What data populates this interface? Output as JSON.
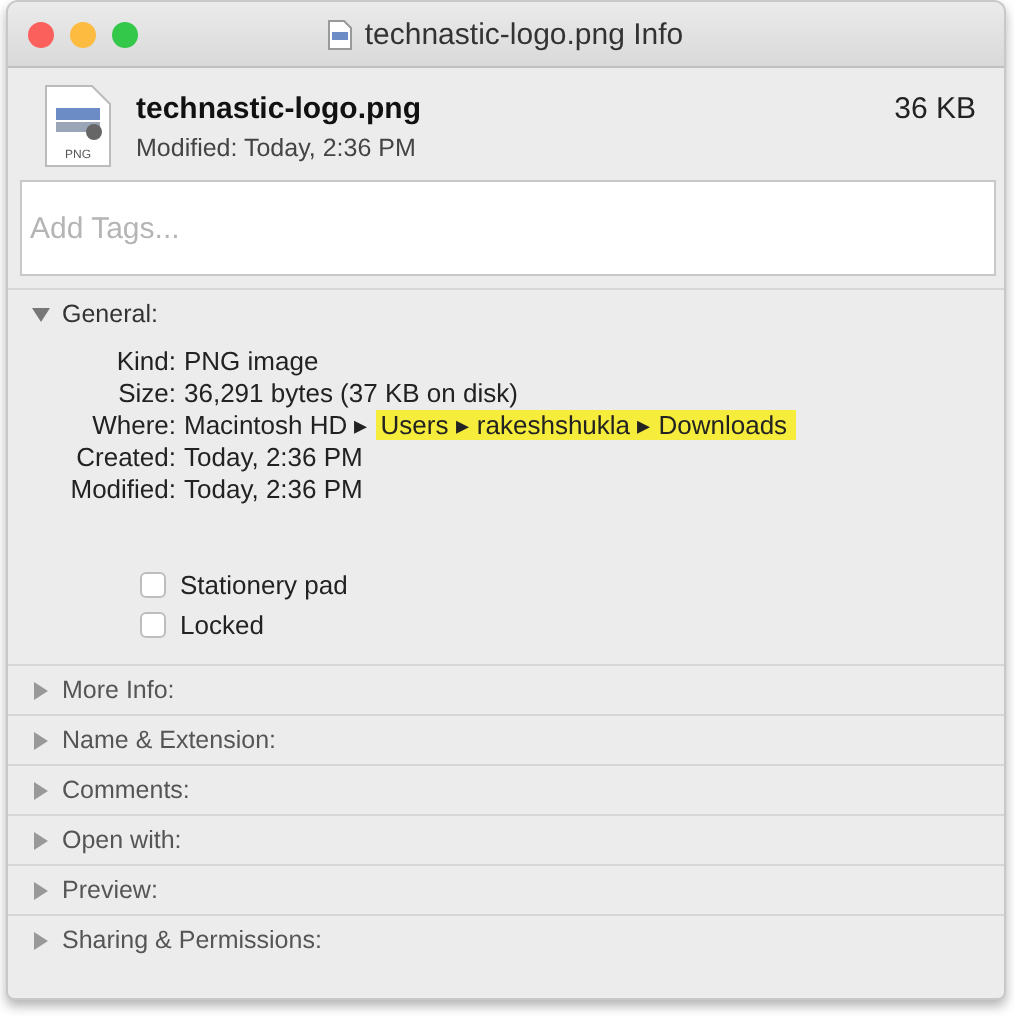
{
  "window": {
    "title": "technastic-logo.png Info"
  },
  "header": {
    "file_name": "technastic-logo.png",
    "modified": "Modified: Today, 2:36 PM",
    "size": "36 KB",
    "icon_label": "PNG"
  },
  "tags": {
    "placeholder": "Add Tags..."
  },
  "sections": [
    {
      "title": "General:",
      "expanded": true,
      "rows": [
        {
          "label": "Kind:",
          "parts": [
            {
              "text": "PNG image",
              "highlighted": false
            }
          ]
        },
        {
          "label": "Size:",
          "parts": [
            {
              "text": "36,291 bytes (37 KB on disk)",
              "highlighted": false
            }
          ]
        },
        {
          "label": "Where:",
          "parts": [
            {
              "text": "Macintosh HD ▸",
              "highlighted": false
            },
            {
              "text": "Users ▸ rakeshshukla ▸ Downloads",
              "highlighted": true
            }
          ]
        },
        {
          "label": "Created:",
          "parts": [
            {
              "text": "Today, 2:36 PM",
              "highlighted": false
            }
          ]
        },
        {
          "label": "Modified:",
          "parts": [
            {
              "text": "Today, 2:36 PM",
              "highlighted": false
            }
          ]
        }
      ],
      "checkboxes": [
        {
          "label": "Stationery pad",
          "checked": false
        },
        {
          "label": "Locked",
          "checked": false
        }
      ]
    },
    {
      "title": "More Info:",
      "expanded": false
    },
    {
      "title": "Name & Extension:",
      "expanded": false
    },
    {
      "title": "Comments:",
      "expanded": false
    },
    {
      "title": "Open with:",
      "expanded": false
    },
    {
      "title": "Preview:",
      "expanded": false
    },
    {
      "title": "Sharing & Permissions:",
      "expanded": false
    }
  ]
}
